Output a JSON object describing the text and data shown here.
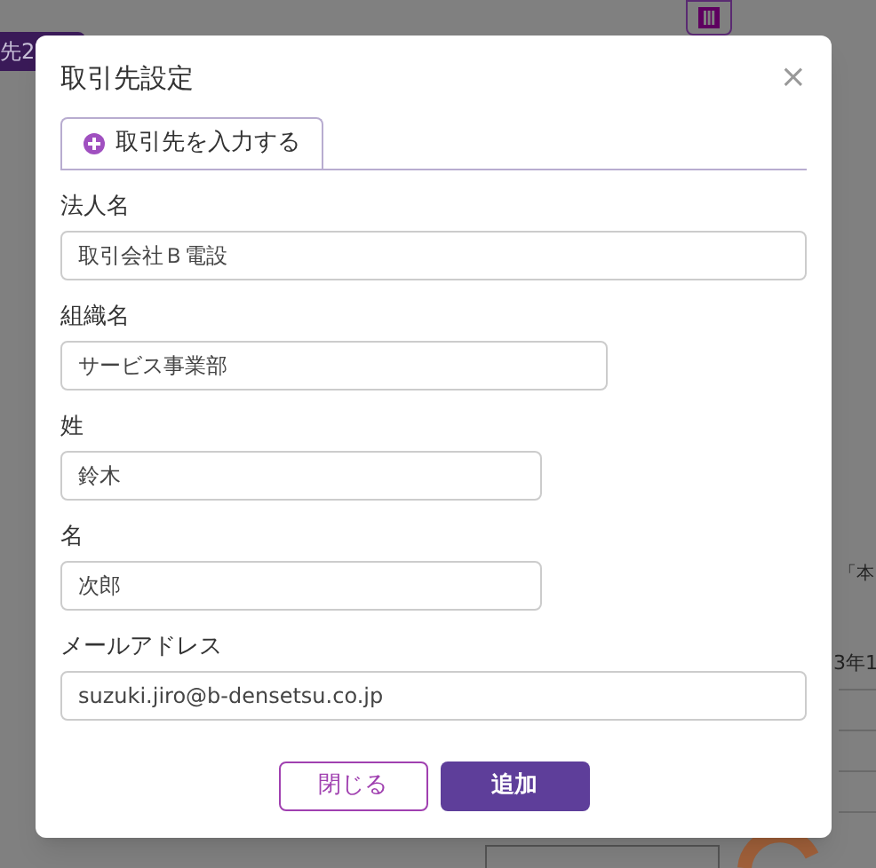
{
  "background": {
    "button": "先2",
    "note": "「本",
    "date": "3年1"
  },
  "dialog": {
    "title": "取引先設定",
    "close": "×",
    "tabs": [
      {
        "label": "取引先を入力する",
        "selected": true
      }
    ],
    "fields": [
      {
        "label": "法人名",
        "value": "取引会社Ｂ電設"
      },
      {
        "label": "組織名",
        "value": "サービス事業部"
      },
      {
        "label": "姓",
        "value": "鈴木"
      },
      {
        "label": "名",
        "value": "次郎"
      },
      {
        "label": "メールアドレス",
        "value": "suzuki.jiro@b-densetsu.co.jp"
      }
    ],
    "buttons": [
      {
        "label": "閉じる",
        "kind": "secondary"
      },
      {
        "label": "追加",
        "kind": "primary"
      }
    ]
  }
}
